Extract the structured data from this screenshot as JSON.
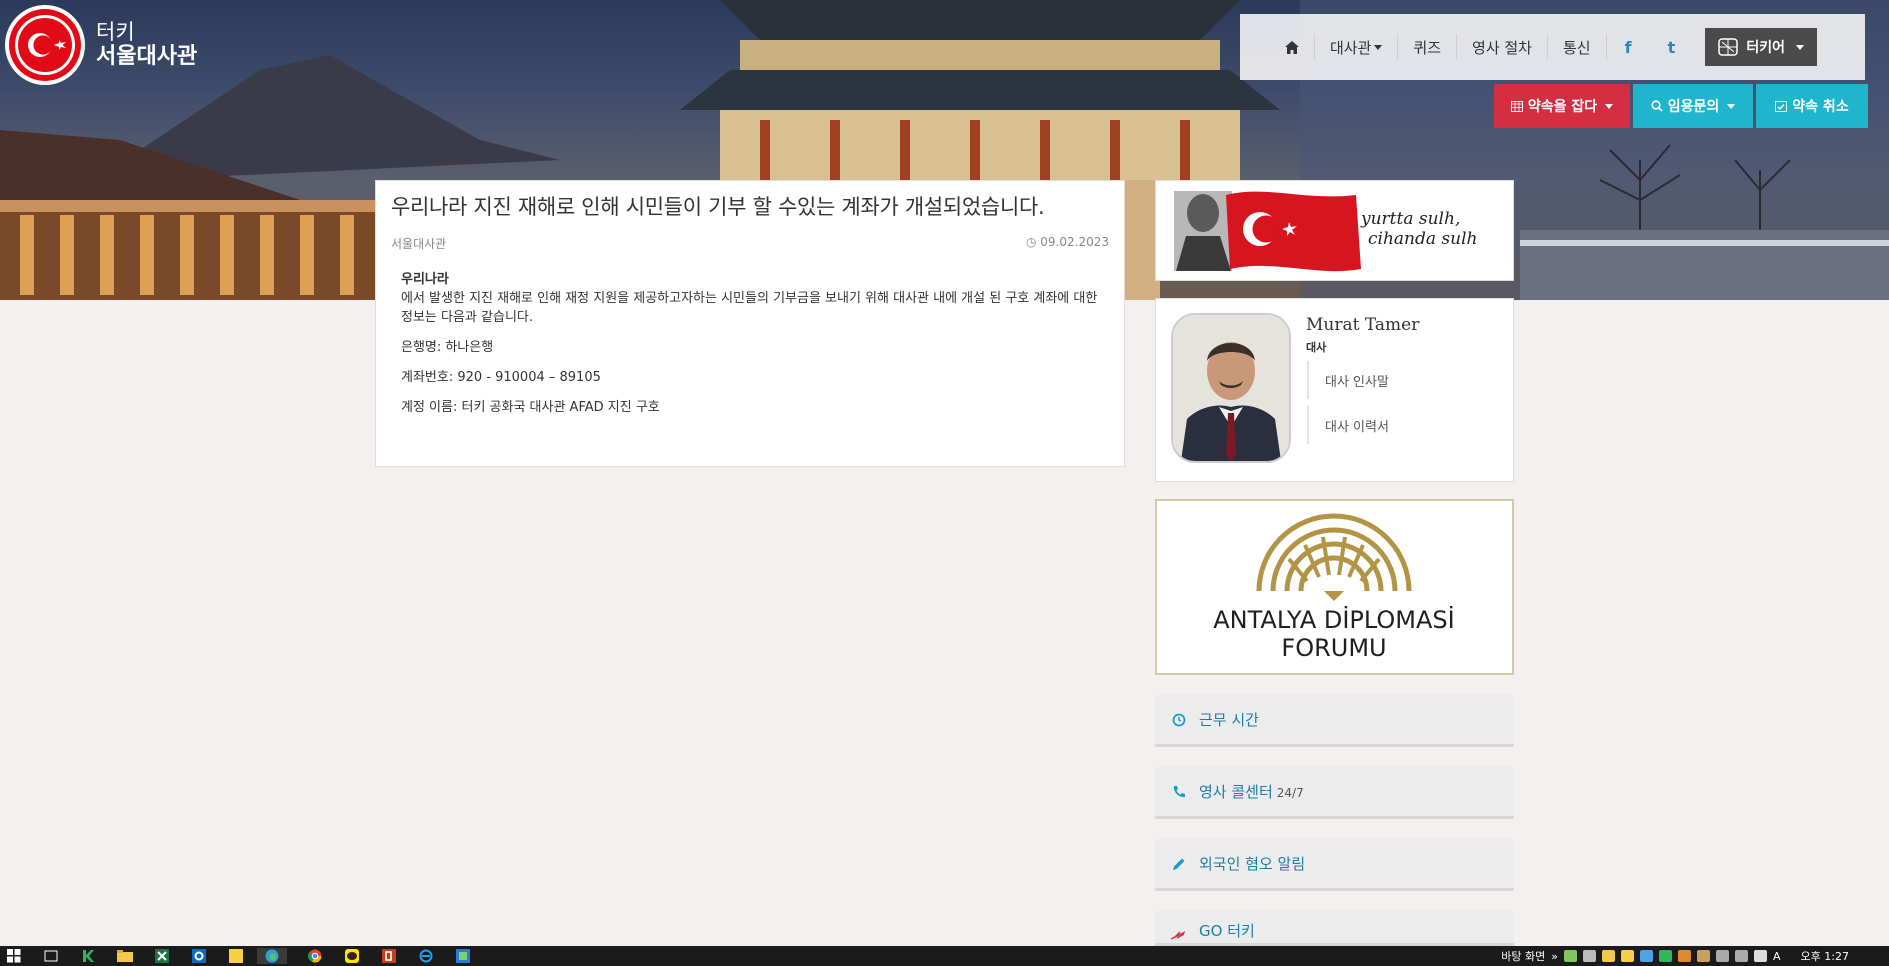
{
  "logo": {
    "line1": "터키",
    "line2": "서울대사관"
  },
  "nav": {
    "items": [
      "대사관",
      "퀴즈",
      "영사 절차",
      "통신"
    ],
    "social": [
      "f",
      "t"
    ],
    "language": "터키어"
  },
  "actions": {
    "book": "약속을 잡다",
    "inquiry": "임용문의",
    "cancel": "약속 취소"
  },
  "article": {
    "title": "우리나라 지진 재해로 인해 시민들이 기부 할 수있는 계좌가 개설되었습니다.",
    "source": "서울대사관",
    "date": "09.02.2023",
    "intro_bold": "우리나라",
    "intro": "에서 발생한 지진 재해로 인해 재정 지원을 제공하고자하는 시민들의 기부금을 보내기 위해 대사관 내에 개설 된 구호 계좌에 대한 정보는 다음과 같습니다.",
    "bank": "은행명: 하나은행",
    "account": "계좌번호: 920 - 910004 – 89105",
    "holder": "계정 이름: 터키 공화국 대사관 AFAD 지진 구호"
  },
  "banner": {
    "motto_line1": "yurtta sulh,",
    "motto_line2": "cihanda sulh"
  },
  "ambassador": {
    "name": "Murat Tamer",
    "role": "대사",
    "links": [
      "대사 인사말",
      "대사 이력서"
    ]
  },
  "adf": {
    "line1": "ANTALYA DİPLOMASİ",
    "line2": "FORUMU"
  },
  "side_links": [
    {
      "label": "근무 시간",
      "extra": ""
    },
    {
      "label": "영사 콜센터",
      "extra": "24/7"
    },
    {
      "label": "외국인 혐오 알림",
      "extra": ""
    },
    {
      "label": "GO 터키",
      "extra": ""
    }
  ],
  "taskbar": {
    "desktop": "바탕 화면",
    "time": "오후 1:27",
    "ime": "A",
    "chevron": "»"
  },
  "colors": {
    "red": "#d42e42",
    "cyan": "#1fb5cc",
    "link": "#1b7fa3"
  }
}
